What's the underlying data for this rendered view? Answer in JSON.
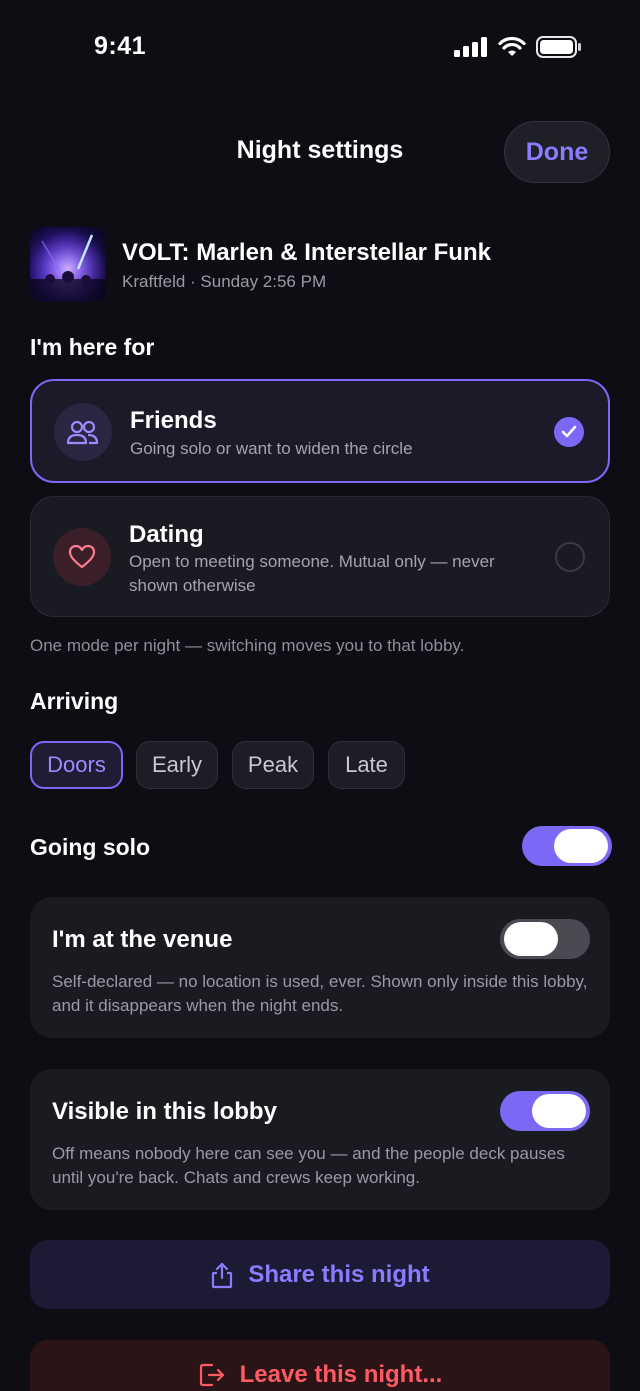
{
  "status_bar": {
    "time": "9:41"
  },
  "header": {
    "title": "Night settings",
    "done_label": "Done"
  },
  "event": {
    "title": "VOLT: Marlen & Interstellar Funk",
    "subtitle": "Kraftfeld · Sunday 2:56 PM"
  },
  "mode_section": {
    "label": "I'm here for",
    "options": [
      {
        "title": "Friends",
        "description": "Going solo or want to widen the circle",
        "selected": true,
        "icon": "people-icon"
      },
      {
        "title": "Dating",
        "description": "Open to meeting someone. Mutual only — never shown otherwise",
        "selected": false,
        "icon": "heart-icon"
      }
    ],
    "hint": "One mode per night — switching moves you to that lobby."
  },
  "arriving": {
    "label": "Arriving",
    "options": [
      "Doors",
      "Early",
      "Peak",
      "Late"
    ],
    "selected": "Doors"
  },
  "going_solo": {
    "label": "Going solo",
    "enabled": true
  },
  "at_venue": {
    "title": "I'm at the venue",
    "description": "Self-declared — no location is used, ever. Shown only inside this lobby, and it disappears when the night ends.",
    "enabled": false
  },
  "visible": {
    "title": "Visible in this lobby",
    "description": "Off means nobody here can see you — and the people deck pauses until you're back. Chats and crews keep working.",
    "enabled": true
  },
  "actions": {
    "share_label": "Share this night",
    "leave_label": "Leave this night..."
  },
  "colors": {
    "accent": "#7b68f5",
    "danger": "#ff5a64",
    "background": "#0d0d13"
  }
}
